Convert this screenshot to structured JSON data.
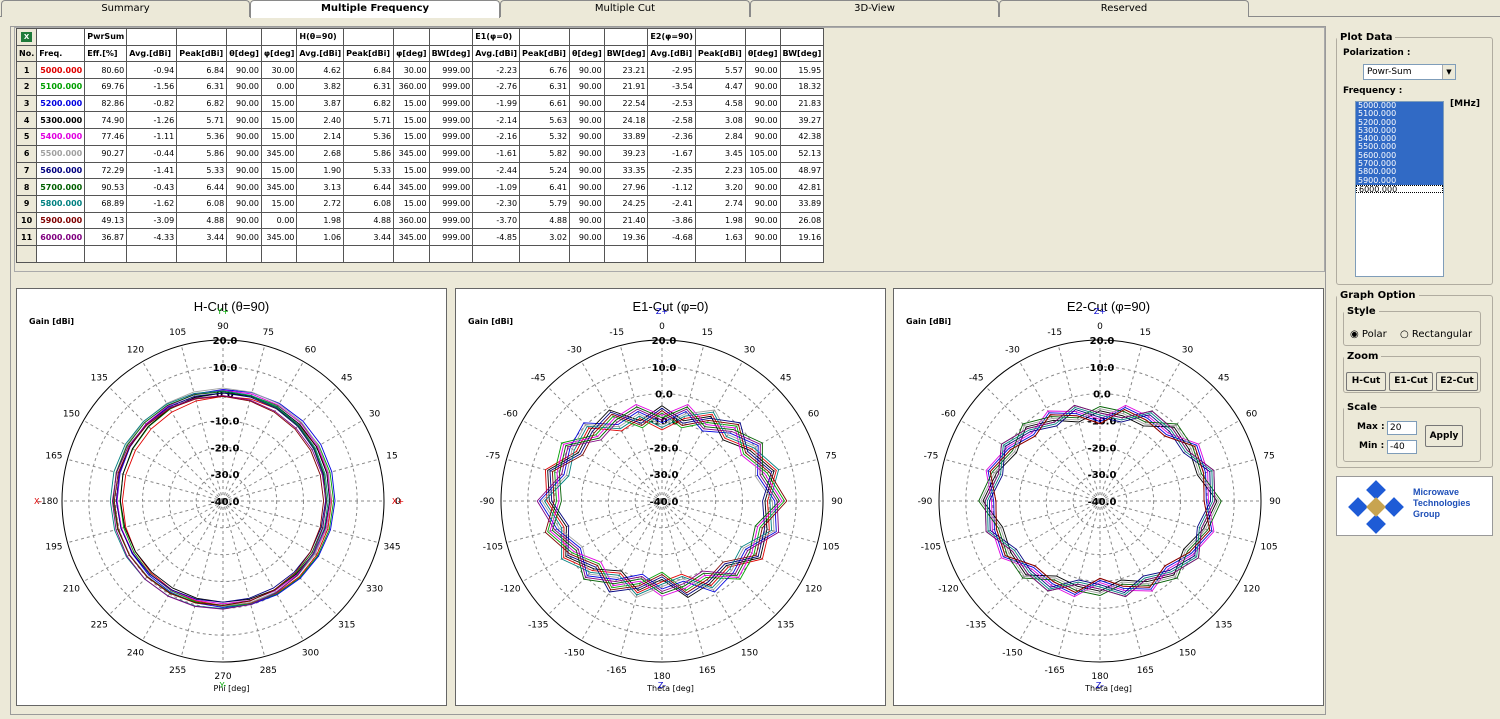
{
  "tabs": [
    {
      "label": "Summary"
    },
    {
      "label": "Multiple Frequency"
    },
    {
      "label": "Multiple Cut"
    },
    {
      "label": "3D-View"
    },
    {
      "label": "Reserved"
    }
  ],
  "table": {
    "groups": [
      "PwrSum",
      "H(θ=90)",
      "E1(φ=0)",
      "E2(φ=90)"
    ],
    "headers": [
      "No.",
      "Freq.",
      "Eff.[%]",
      "Avg.[dBi]",
      "Peak[dBi]",
      "θ[deg]",
      "φ[deg]",
      "Avg.[dBi]",
      "Peak[dBi]",
      "φ[deg]",
      "BW[deg]",
      "Avg.[dBi]",
      "Peak[dBi]",
      "θ[deg]",
      "BW[deg]",
      "Avg.[dBi]",
      "Peak[dBi]",
      "θ[deg]",
      "BW[deg]"
    ],
    "rows": [
      [
        "1",
        "5000.000",
        "80.60",
        "-0.94",
        "6.84",
        "90.00",
        "30.00",
        "4.62",
        "6.84",
        "30.00",
        "999.00",
        "-2.23",
        "6.76",
        "90.00",
        "23.21",
        "-2.95",
        "5.57",
        "90.00",
        "15.95"
      ],
      [
        "2",
        "5100.000",
        "69.76",
        "-1.56",
        "6.31",
        "90.00",
        "0.00",
        "3.82",
        "6.31",
        "360.00",
        "999.00",
        "-2.76",
        "6.31",
        "90.00",
        "21.91",
        "-3.54",
        "4.47",
        "90.00",
        "18.32"
      ],
      [
        "3",
        "5200.000",
        "82.86",
        "-0.82",
        "6.82",
        "90.00",
        "15.00",
        "3.87",
        "6.82",
        "15.00",
        "999.00",
        "-1.99",
        "6.61",
        "90.00",
        "22.54",
        "-2.53",
        "4.58",
        "90.00",
        "21.83"
      ],
      [
        "4",
        "5300.000",
        "74.90",
        "-1.26",
        "5.71",
        "90.00",
        "15.00",
        "2.40",
        "5.71",
        "15.00",
        "999.00",
        "-2.14",
        "5.63",
        "90.00",
        "24.18",
        "-2.58",
        "3.08",
        "90.00",
        "39.27"
      ],
      [
        "5",
        "5400.000",
        "77.46",
        "-1.11",
        "5.36",
        "90.00",
        "15.00",
        "2.14",
        "5.36",
        "15.00",
        "999.00",
        "-2.16",
        "5.32",
        "90.00",
        "33.89",
        "-2.36",
        "2.84",
        "90.00",
        "42.38"
      ],
      [
        "6",
        "5500.000",
        "90.27",
        "-0.44",
        "5.86",
        "90.00",
        "345.00",
        "2.68",
        "5.86",
        "345.00",
        "999.00",
        "-1.61",
        "5.82",
        "90.00",
        "39.23",
        "-1.67",
        "3.45",
        "105.00",
        "52.13"
      ],
      [
        "7",
        "5600.000",
        "72.29",
        "-1.41",
        "5.33",
        "90.00",
        "15.00",
        "1.90",
        "5.33",
        "15.00",
        "999.00",
        "-2.44",
        "5.24",
        "90.00",
        "33.35",
        "-2.35",
        "2.23",
        "105.00",
        "48.97"
      ],
      [
        "8",
        "5700.000",
        "90.53",
        "-0.43",
        "6.44",
        "90.00",
        "345.00",
        "3.13",
        "6.44",
        "345.00",
        "999.00",
        "-1.09",
        "6.41",
        "90.00",
        "27.96",
        "-1.12",
        "3.20",
        "90.00",
        "42.81"
      ],
      [
        "9",
        "5800.000",
        "68.89",
        "-1.62",
        "6.08",
        "90.00",
        "15.00",
        "2.72",
        "6.08",
        "15.00",
        "999.00",
        "-2.30",
        "5.79",
        "90.00",
        "24.25",
        "-2.41",
        "2.74",
        "90.00",
        "33.89"
      ],
      [
        "10",
        "5900.000",
        "49.13",
        "-3.09",
        "4.88",
        "90.00",
        "0.00",
        "1.98",
        "4.88",
        "360.00",
        "999.00",
        "-3.70",
        "4.88",
        "90.00",
        "21.40",
        "-3.86",
        "1.98",
        "90.00",
        "26.08"
      ],
      [
        "11",
        "6000.000",
        "36.87",
        "-4.33",
        "3.44",
        "90.00",
        "345.00",
        "1.06",
        "3.44",
        "345.00",
        "999.00",
        "-4.85",
        "3.02",
        "90.00",
        "19.36",
        "-4.68",
        "1.63",
        "90.00",
        "19.16"
      ]
    ],
    "freq_colors": [
      "#e00000",
      "#00a000",
      "#0000e0",
      "#000000",
      "#e000e0",
      "#a0a0a0",
      "#000080",
      "#006000",
      "#008080",
      "#800000",
      "#800080"
    ]
  },
  "plots": [
    {
      "title": "H-Cut (θ=90)",
      "gain_label": "Gain [dBi]",
      "axis_label": "Phi [deg]",
      "angle_labels": [
        "0",
        "15",
        "30",
        "45",
        "60",
        "75",
        "90",
        "105",
        "120",
        "135",
        "150",
        "165",
        "-180",
        "195",
        "210",
        "225",
        "240",
        "255",
        "270",
        "285",
        "300",
        "315",
        "330",
        "345"
      ],
      "top_axis": "Y+",
      "bottom_axis": "Y-",
      "left_axis": "X-",
      "right_axis": "X+"
    },
    {
      "title": "E1-Cut (φ=0)",
      "gain_label": "Gain [dBi]",
      "axis_label": "Theta [deg]",
      "angle_labels": [
        "0",
        "15",
        "30",
        "45",
        "60",
        "75",
        "90",
        "105",
        "120",
        "135",
        "150",
        "165",
        "180",
        "-165",
        "-150",
        "-135",
        "-120",
        "-105",
        "-90",
        "-75",
        "-60",
        "-45",
        "-30",
        "-15"
      ],
      "top_axis": "Z+",
      "bottom_axis": "Z-",
      "left_axis": "",
      "right_axis": ""
    },
    {
      "title": "E2-Cut (φ=90)",
      "gain_label": "Gain [dBi]",
      "axis_label": "Theta [deg]",
      "angle_labels": [
        "0",
        "15",
        "30",
        "45",
        "60",
        "75",
        "90",
        "105",
        "120",
        "135",
        "150",
        "165",
        "180",
        "-165",
        "-150",
        "-135",
        "-120",
        "-105",
        "-90",
        "-75",
        "-60",
        "-45",
        "-30",
        "-15"
      ],
      "top_axis": "Z+",
      "bottom_axis": "Z-",
      "left_axis": "",
      "right_axis": ""
    }
  ],
  "ring_labels": [
    "20.0",
    "10.0",
    "0.0",
    "-10.0",
    "-20.0",
    "-30.0",
    "-40.0"
  ],
  "side": {
    "plot_data_title": "Plot Data",
    "polarization_label": "Polarization :",
    "polarization_value": "Powr-Sum",
    "frequency_label": "Frequency :",
    "unit": "[MHz]",
    "frequencies": [
      "5000.000",
      "5100.000",
      "5200.000",
      "5300.000",
      "5400.000",
      "5500.000",
      "5600.000",
      "5700.000",
      "5800.000",
      "5900.000",
      "6000.000"
    ],
    "graph_option_title": "Graph Option",
    "style_title": "Style",
    "polar_label": "Polar",
    "rect_label": "Rectangular",
    "zoom_title": "Zoom",
    "zoom_h": "H-Cut",
    "zoom_e1": "E1-Cut",
    "zoom_e2": "E2-Cut",
    "scale_title": "Scale",
    "max_label": "Max :",
    "min_label": "Min :",
    "max_value": "20",
    "min_value": "-40",
    "apply_label": "Apply",
    "logo_text": [
      "Microwave",
      "Technologies",
      "Group"
    ]
  }
}
